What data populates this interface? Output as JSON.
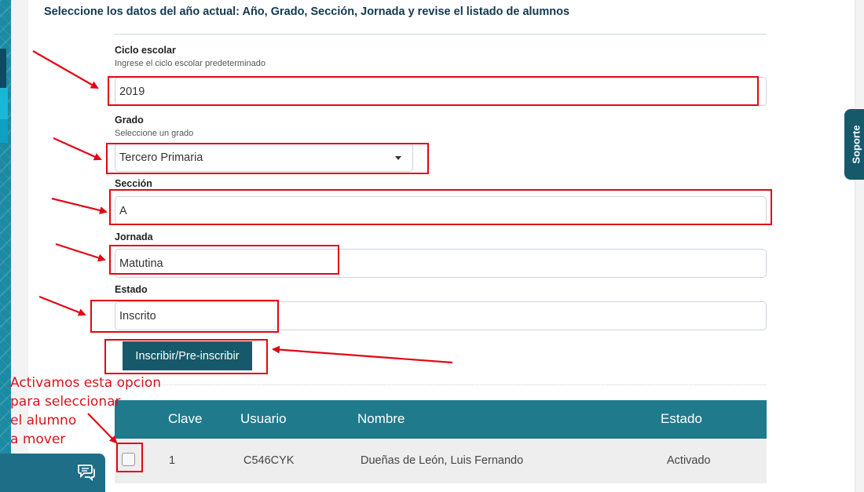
{
  "form": {
    "heading": "Seleccione los datos del año actual: Año, Grado, Sección, Jornada y revise el listado de alumnos",
    "ciclo": {
      "label": "Ciclo escolar",
      "hint": "Ingrese el ciclo escolar predeterminado",
      "value": "2019"
    },
    "grado": {
      "label": "Grado",
      "hint": "Seleccione un grado",
      "value": "Tercero Primaria"
    },
    "seccion": {
      "label": "Sección",
      "value": "A"
    },
    "jornada": {
      "label": "Jornada",
      "value": "Matutina"
    },
    "estado": {
      "label": "Estado",
      "value": "Inscrito"
    },
    "submit_label": "Inscribir/Pre-inscribir"
  },
  "table": {
    "columns": [
      "Clave",
      "Usuario",
      "Nombre",
      "Estado"
    ],
    "rows": [
      {
        "clave": "1",
        "usuario": "C546CYK",
        "nombre": "Dueñas de León, Luis Fernando",
        "estado": "Activado",
        "checked": false
      }
    ]
  },
  "support_tab_label": "Soporte",
  "annotation": {
    "lines": [
      "Activamos esta opcion",
      "para seleccionar",
      "el alumno",
      "a mover"
    ],
    "color": "#e30613"
  },
  "theme": {
    "primary": "#15596a",
    "table_header": "#1f7a8c",
    "accent_red": "#e30613"
  }
}
